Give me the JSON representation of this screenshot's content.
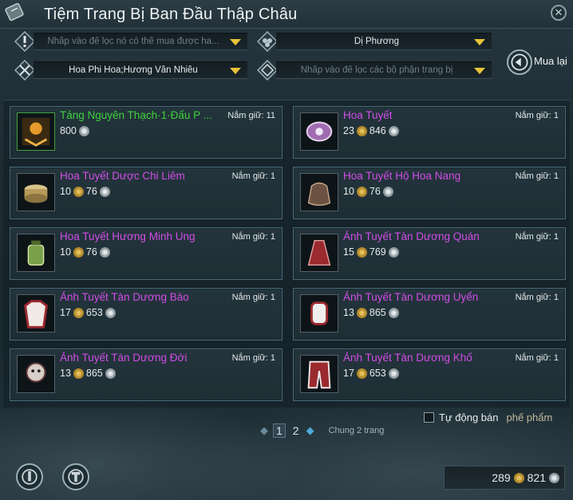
{
  "window": {
    "title": "Tiệm Trang Bị Ban Đầu Thập Châu",
    "close_symbol": "✕"
  },
  "filters": {
    "affordable": {
      "placeholder": "Nhấp vào để lọc nó có thể  mua được ha..."
    },
    "faction": {
      "value": "Dị Phương"
    },
    "set": {
      "value": "Hoa Phi Hoa;Hương Vân Nhiễu"
    },
    "part": {
      "placeholder": "Nhấp vào để lọc các bộ phận trang bị"
    }
  },
  "rebuy": {
    "label": "Mua lại"
  },
  "items": [
    {
      "name": "Tảng Nguyên Thạch·1·Đấu P ...",
      "rarity": "green",
      "hold": "Nắm giữ: 11",
      "gold": "",
      "silver": "800",
      "icon": "stone-icon"
    },
    {
      "name": "Hoa Tuyết",
      "rarity": "purple",
      "hold": "Nắm giữ: 1",
      "gold": "23",
      "silver": "846",
      "icon": "hairpin-icon"
    },
    {
      "name": "Hoa Tuyết Dược Chi Liêm",
      "rarity": "purple",
      "hold": "Nắm giữ: 1",
      "gold": "10",
      "silver": "76",
      "icon": "box-icon"
    },
    {
      "name": "Hoa Tuyết Hộ Hoa Nang",
      "rarity": "purple",
      "hold": "Nắm giữ: 1",
      "gold": "10",
      "silver": "76",
      "icon": "pouch-icon"
    },
    {
      "name": "Hoa Tuyết Hương Minh Ung",
      "rarity": "purple",
      "hold": "Nắm giữ: 1",
      "gold": "10",
      "silver": "76",
      "icon": "jar-icon"
    },
    {
      "name": "Ảnh Tuyết Tàn Dương Quán",
      "rarity": "purple",
      "hold": "Nắm giữ: 1",
      "gold": "15",
      "silver": "769",
      "icon": "hood-icon"
    },
    {
      "name": "Ảnh Tuyết Tàn Dương Bào",
      "rarity": "purple",
      "hold": "Nắm giữ: 1",
      "gold": "17",
      "silver": "653",
      "icon": "robe-icon"
    },
    {
      "name": "Ảnh Tuyết Tàn Dương Uyển",
      "rarity": "purple",
      "hold": "Nắm giữ: 1",
      "gold": "13",
      "silver": "865",
      "icon": "bracer-icon"
    },
    {
      "name": "Ảnh Tuyết Tàn Dương Đới",
      "rarity": "purple",
      "hold": "Nắm giữ: 1",
      "gold": "13",
      "silver": "865",
      "icon": "belt-icon"
    },
    {
      "name": "Ảnh Tuyết Tàn Dương Khố",
      "rarity": "purple",
      "hold": "Nắm giữ: 1",
      "gold": "17",
      "silver": "653",
      "icon": "pants-icon"
    }
  ],
  "pagination": {
    "pages": [
      "1",
      "2"
    ],
    "current": "1",
    "total": "Chung 2 trang"
  },
  "autosell": {
    "label": "Tự động bán",
    "value": "phế phẩm",
    "checked": false
  },
  "wallet": {
    "gold": "289",
    "silver": "821"
  },
  "colors": {
    "purple": "#d14de6",
    "green": "#3fd23c",
    "caret": "#e9c23a",
    "card_border": "#4a6a78"
  }
}
